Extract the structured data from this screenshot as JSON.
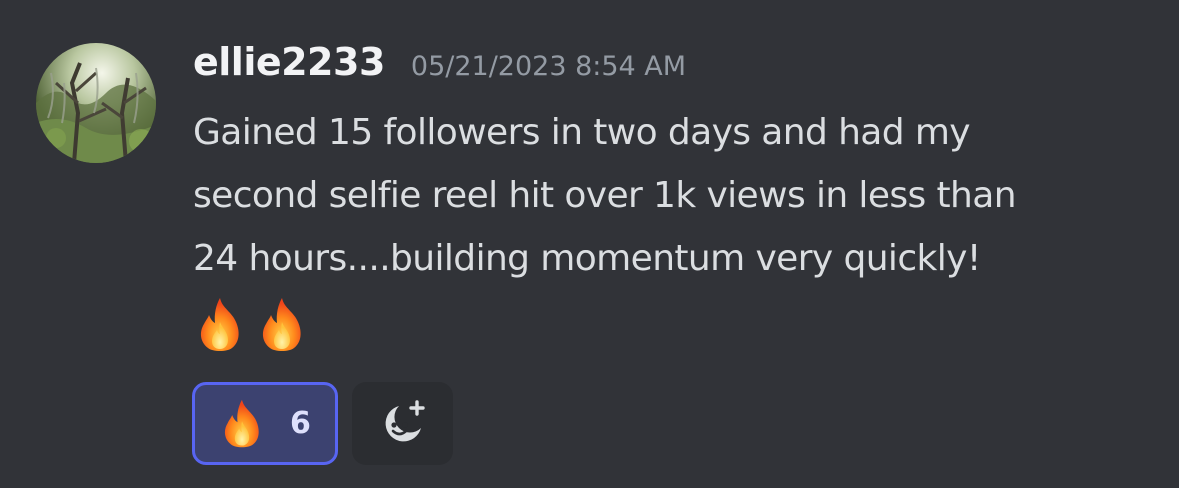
{
  "message": {
    "username": "ellie2233",
    "timestamp": "05/21/2023 8:54 AM",
    "lines": [
      "Gained 15 followers in two days and had my",
      "second selfie reel hit over 1k views in less than",
      "24 hours....building momentum very quickly!"
    ],
    "emojis": [
      "fire-emoji",
      "fire-emoji"
    ]
  },
  "reactions": [
    {
      "emoji": "fire-emoji",
      "count": "6",
      "active": true
    }
  ],
  "add_reaction": {
    "icon": "add-reaction-icon"
  },
  "colors": {
    "background": "#313338",
    "username": "#f2f3f5",
    "timestamp": "#949ba4",
    "text": "#dbdee1",
    "reaction_active_bg": "#3c4270",
    "reaction_active_border": "#5865f2",
    "add_reaction_bg": "#2b2d31"
  }
}
